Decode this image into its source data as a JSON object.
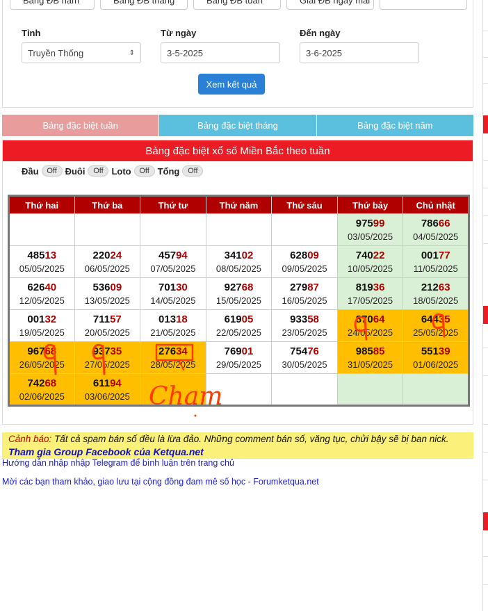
{
  "top_buttons": [
    "Bảng ĐB năm",
    "Bảng ĐB tháng",
    "Bảng ĐB tuần",
    "Giải ĐB ngày mai",
    ""
  ],
  "form": {
    "province_label": "Tỉnh",
    "province_value": "Truyền Thống",
    "from_label": "Từ ngày",
    "from_value": "3-5-2025",
    "to_label": "Đến ngày",
    "to_value": "3-6-2025",
    "submit_label": "Xem kết quả"
  },
  "tabs": [
    "Bảng đặc biệt tuần",
    "Bảng đặc biệt tháng",
    "Bảng đặc biệt năm"
  ],
  "box_title": "Bảng đặc biệt xổ số Miền Bắc theo tuần",
  "toggles": [
    {
      "label": "Đầu",
      "state": "Off"
    },
    {
      "label": "Đuôi",
      "state": "Off"
    },
    {
      "label": "Loto",
      "state": "Off"
    },
    {
      "label": "Tổng",
      "state": "Off"
    }
  ],
  "weekdays": [
    "Thứ hai",
    "Thứ ba",
    "Thứ tư",
    "Thứ năm",
    "Thứ sáu",
    "Thứ bảy",
    "Chủ nhật"
  ],
  "weeks": [
    [
      {
        "head": "",
        "tail": "",
        "date": "",
        "bg": "white"
      },
      {
        "head": "",
        "tail": "",
        "date": "",
        "bg": "white"
      },
      {
        "head": "",
        "tail": "",
        "date": "",
        "bg": "white"
      },
      {
        "head": "",
        "tail": "",
        "date": "",
        "bg": "white"
      },
      {
        "head": "",
        "tail": "",
        "date": "",
        "bg": "white"
      },
      {
        "head": "975",
        "tail": "99",
        "date": "03/05/2025",
        "bg": "green"
      },
      {
        "head": "786",
        "tail": "66",
        "date": "04/05/2025",
        "bg": "green"
      }
    ],
    [
      {
        "head": "485",
        "tail": "13",
        "date": "05/05/2025",
        "bg": "white"
      },
      {
        "head": "220",
        "tail": "24",
        "date": "06/05/2025",
        "bg": "white"
      },
      {
        "head": "457",
        "tail": "94",
        "date": "07/05/2025",
        "bg": "white"
      },
      {
        "head": "341",
        "tail": "02",
        "date": "08/05/2025",
        "bg": "white"
      },
      {
        "head": "628",
        "tail": "09",
        "date": "09/05/2025",
        "bg": "white"
      },
      {
        "head": "740",
        "tail": "22",
        "date": "10/05/2025",
        "bg": "green"
      },
      {
        "head": "001",
        "tail": "77",
        "date": "11/05/2025",
        "bg": "green"
      }
    ],
    [
      {
        "head": "626",
        "tail": "40",
        "date": "12/05/2025",
        "bg": "white"
      },
      {
        "head": "536",
        "tail": "09",
        "date": "13/05/2025",
        "bg": "white"
      },
      {
        "head": "701",
        "tail": "30",
        "date": "14/05/2025",
        "bg": "white"
      },
      {
        "head": "927",
        "tail": "68",
        "date": "15/05/2025",
        "bg": "white"
      },
      {
        "head": "279",
        "tail": "87",
        "date": "16/05/2025",
        "bg": "white"
      },
      {
        "head": "819",
        "tail": "36",
        "date": "17/05/2025",
        "bg": "green"
      },
      {
        "head": "212",
        "tail": "63",
        "date": "18/05/2025",
        "bg": "green"
      }
    ],
    [
      {
        "head": "001",
        "tail": "32",
        "date": "19/05/2025",
        "bg": "white"
      },
      {
        "head": "711",
        "tail": "57",
        "date": "20/05/2025",
        "bg": "white"
      },
      {
        "head": "013",
        "tail": "18",
        "date": "21/05/2025",
        "bg": "white"
      },
      {
        "head": "619",
        "tail": "05",
        "date": "22/05/2025",
        "bg": "white"
      },
      {
        "head": "933",
        "tail": "58",
        "date": "23/05/2025",
        "bg": "white"
      },
      {
        "head": "870",
        "tail": "64",
        "date": "24/05/2025",
        "bg": "orange"
      },
      {
        "head": "644",
        "tail": "35",
        "date": "25/05/2025",
        "bg": "orange"
      }
    ],
    [
      {
        "head": "967",
        "tail": "68",
        "date": "26/05/2025",
        "bg": "orange"
      },
      {
        "head": "937",
        "tail": "35",
        "date": "27/05/2025",
        "bg": "orange"
      },
      {
        "head": "276",
        "tail": "34",
        "date": "28/05/2025",
        "bg": "orange"
      },
      {
        "head": "769",
        "tail": "01",
        "date": "29/05/2025",
        "bg": "white"
      },
      {
        "head": "754",
        "tail": "76",
        "date": "30/05/2025",
        "bg": "white"
      },
      {
        "head": "985",
        "tail": "85",
        "date": "31/05/2025",
        "bg": "orange"
      },
      {
        "head": "551",
        "tail": "39",
        "date": "01/06/2025",
        "bg": "orange"
      }
    ],
    [
      {
        "head": "742",
        "tail": "68",
        "date": "02/06/2025",
        "bg": "orange"
      },
      {
        "head": "611",
        "tail": "94",
        "date": "03/06/2025",
        "bg": "orange"
      },
      {
        "head": "",
        "tail": "",
        "date": "",
        "bg": "orange"
      },
      {
        "head": "",
        "tail": "",
        "date": "",
        "bg": "white"
      },
      {
        "head": "",
        "tail": "",
        "date": "",
        "bg": "white"
      },
      {
        "head": "",
        "tail": "",
        "date": "",
        "bg": "green"
      },
      {
        "head": "",
        "tail": "",
        "date": "",
        "bg": "green"
      }
    ]
  ],
  "handwriting": "Cham",
  "warning": {
    "label": "Cảnh báo:",
    "text": " Tất cả spam bán số đều là lừa đảo. Những comment bán số, văng tục, chửi bậy sẽ bị ban nick.",
    "facebook": "Tham gia Group Facebook của Ketqua.net"
  },
  "links": [
    "Hướng dẫn nhập nhập Telegram để bình luận trên trang chủ",
    "Mời các bạn tham khảo, giao lưu tại cộng đồng đam mê số học - Forumketqua.net"
  ],
  "colors": {
    "accent_red": "#ec1c24",
    "header_red": "#b00000",
    "tab_blue": "#5bc0de",
    "highlight_orange": "#ffbf00",
    "highlight_green": "#daf0d6",
    "ink": "#ff3b00"
  }
}
